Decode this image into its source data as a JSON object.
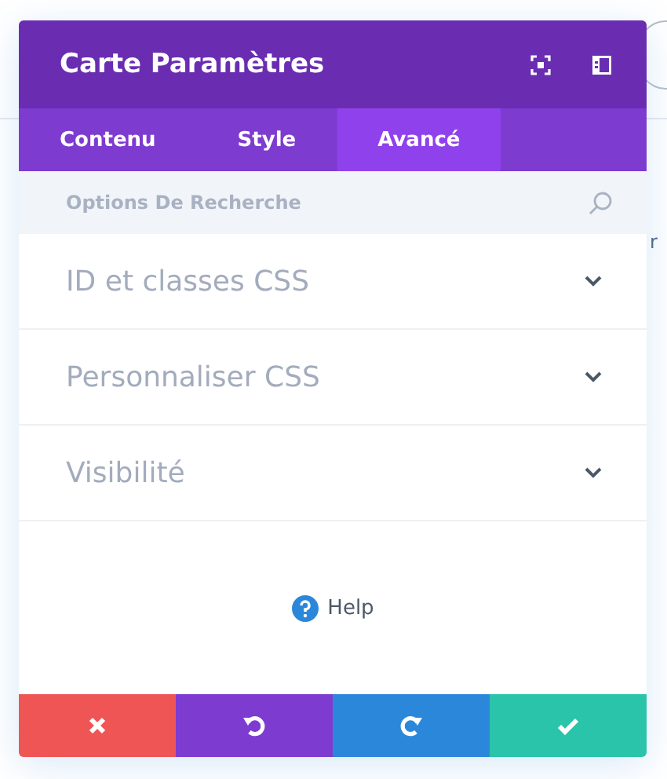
{
  "background": {
    "text_fragment": "r"
  },
  "window": {
    "title": "Carte Paramètres"
  },
  "tabs": [
    {
      "label": "Contenu",
      "selected": false
    },
    {
      "label": "Style",
      "selected": false
    },
    {
      "label": "Avancé",
      "selected": true
    }
  ],
  "search": {
    "placeholder": "Options De Recherche"
  },
  "sections": [
    {
      "label": "ID et classes CSS",
      "expanded": false
    },
    {
      "label": "Personnaliser CSS",
      "expanded": false
    },
    {
      "label": "Visibilité",
      "expanded": false
    }
  ],
  "help": {
    "label": "Help"
  },
  "buttons": [
    {
      "kind": "cancel",
      "color": "#ef5555"
    },
    {
      "kind": "undo",
      "color": "#7e3bd0"
    },
    {
      "kind": "redo",
      "color": "#2b87da"
    },
    {
      "kind": "save",
      "color": "#29c4a9"
    }
  ]
}
